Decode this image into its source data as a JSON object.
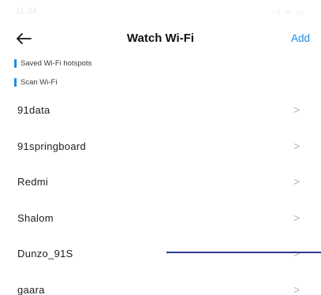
{
  "status_bar": {
    "time": "11:34",
    "icons": "•ıl ᯤ ▭"
  },
  "header": {
    "back_icon": "back-arrow-icon",
    "title": "Watch Wi-Fi",
    "add_label": "Add"
  },
  "sections": {
    "saved_label": "Saved Wi-Fi hotspots",
    "scan_label": "Scan Wi-Fi",
    "accent_color": "#1a8fe6"
  },
  "networks": [
    {
      "name": "91data",
      "chevron": ">"
    },
    {
      "name": "91springboard",
      "chevron": ">"
    },
    {
      "name": "Redmi",
      "chevron": ">"
    },
    {
      "name": "Shalom",
      "chevron": ">"
    },
    {
      "name": "Dunzo_91S",
      "chevron": ">"
    },
    {
      "name": "gaara",
      "chevron": ">"
    }
  ]
}
